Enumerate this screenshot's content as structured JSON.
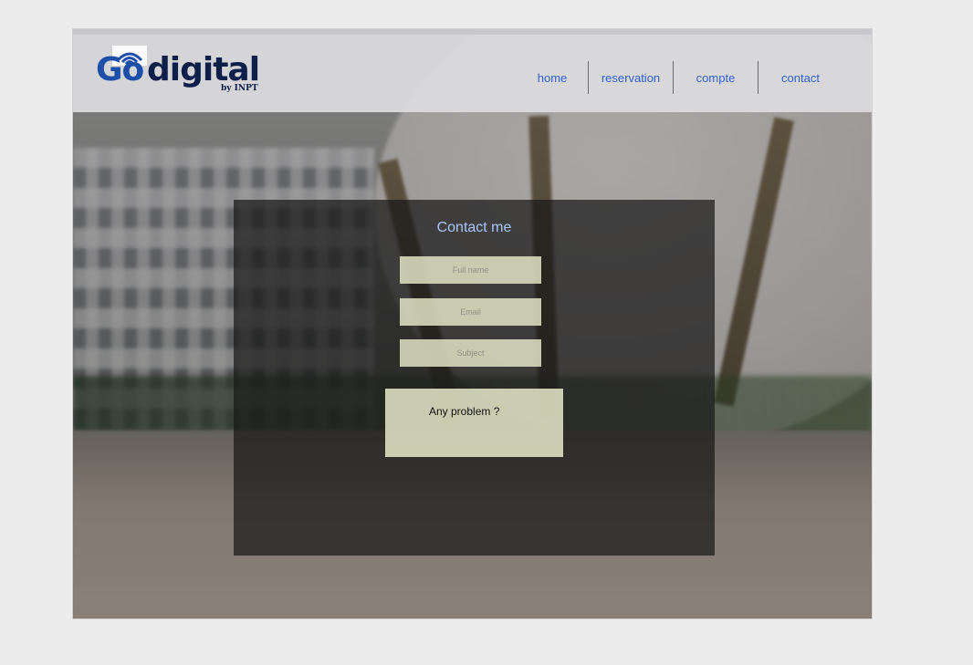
{
  "header": {
    "logo": {
      "go": "Go",
      "digital": "digital",
      "by": "by INPT"
    },
    "nav": [
      {
        "label": "home"
      },
      {
        "label": "reservation"
      },
      {
        "label": "compte"
      },
      {
        "label": "contact"
      }
    ]
  },
  "contact": {
    "title": "Contact me",
    "full_name_placeholder": "Full name",
    "email_placeholder": "Email",
    "subject_placeholder": "Subject",
    "message_placeholder": "Any problem ?"
  },
  "colors": {
    "nav_link": "#2f62d6",
    "title": "#a9c6ff",
    "field_bg": "#e0e4c4",
    "logo_blue": "#1e4fa8",
    "logo_navy": "#0e1f4a"
  }
}
